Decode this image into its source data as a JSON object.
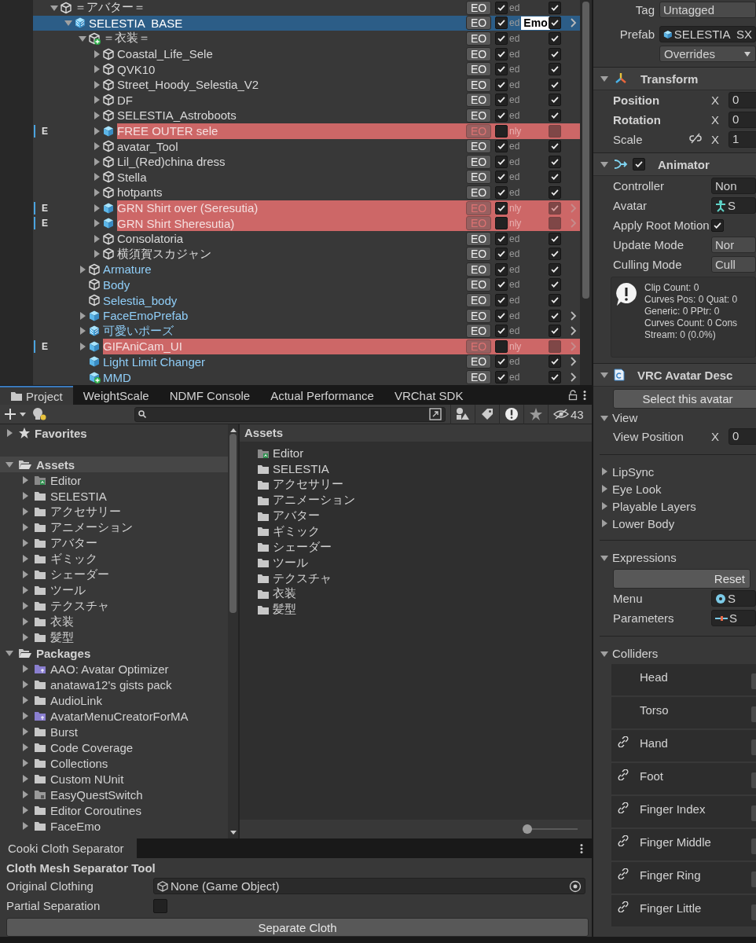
{
  "hierarchy": {
    "rows": [
      {
        "name": "＝アバター＝",
        "kind": "object",
        "expanded": true,
        "selected": false,
        "editor_only": false,
        "in_prefab": false,
        "eo_button": "EO",
        "active": true,
        "status_text": "ed",
        "included": true,
        "chevron": false,
        "children": [
          {
            "name": "SELESTIA  BASE",
            "kind": "prefab_variant",
            "expanded": true,
            "selected": true,
            "editor_only": false,
            "in_prefab": false,
            "eo_button": "EO",
            "active": true,
            "status_text": "ed",
            "tag": "Emo",
            "included": true,
            "chevron": true,
            "children": [
              {
                "name": "＝衣装＝",
                "kind": "added",
                "expanded": true,
                "selected": false,
                "editor_only": false,
                "in_prefab": false,
                "eo_button": "EO",
                "active": true,
                "status_text": "ed",
                "included": true,
                "chevron": false,
                "children": [
                  {
                    "name": "Coastal_Life_Sele",
                    "kind": "object",
                    "expanded": false,
                    "selected": false,
                    "editor_only": false,
                    "in_prefab": false,
                    "eo_button": "EO",
                    "active": true,
                    "status_text": "ed",
                    "included": true,
                    "chevron": false
                  },
                  {
                    "name": "QVK10",
                    "kind": "object",
                    "expanded": false,
                    "selected": false,
                    "editor_only": false,
                    "in_prefab": false,
                    "eo_button": "EO",
                    "active": true,
                    "status_text": "ed",
                    "included": true,
                    "chevron": false
                  },
                  {
                    "name": "Street_Hoody_Selestia_V2",
                    "kind": "object",
                    "expanded": false,
                    "selected": false,
                    "editor_only": false,
                    "in_prefab": false,
                    "eo_button": "EO",
                    "active": true,
                    "status_text": "ed",
                    "included": true,
                    "chevron": false
                  },
                  {
                    "name": "DF",
                    "kind": "object",
                    "expanded": false,
                    "selected": false,
                    "editor_only": false,
                    "in_prefab": false,
                    "eo_button": "EO",
                    "active": true,
                    "status_text": "ed",
                    "included": true,
                    "chevron": false
                  },
                  {
                    "name": "SELESTIA_Astroboots",
                    "kind": "object",
                    "expanded": false,
                    "selected": false,
                    "editor_only": false,
                    "in_prefab": false,
                    "eo_button": "EO",
                    "active": true,
                    "status_text": "ed",
                    "included": true,
                    "chevron": false
                  },
                  {
                    "name": "FREE OUTER sele",
                    "kind": "prefab",
                    "expanded": false,
                    "selected": false,
                    "editor_only": true,
                    "gutter_mark": "E",
                    "in_prefab": false,
                    "eo_button": "EO",
                    "active": false,
                    "status_text": "nly",
                    "included": false,
                    "chevron": false
                  },
                  {
                    "name": "avatar_Tool",
                    "kind": "object",
                    "expanded": false,
                    "selected": false,
                    "editor_only": false,
                    "in_prefab": false,
                    "eo_button": "EO",
                    "active": true,
                    "status_text": "ed",
                    "included": true,
                    "chevron": false
                  },
                  {
                    "name": "Lil_(Red)china dress",
                    "kind": "object",
                    "expanded": false,
                    "selected": false,
                    "editor_only": false,
                    "in_prefab": false,
                    "eo_button": "EO",
                    "active": true,
                    "status_text": "ed",
                    "included": true,
                    "chevron": false
                  },
                  {
                    "name": "Stella",
                    "kind": "object",
                    "expanded": false,
                    "selected": false,
                    "editor_only": false,
                    "in_prefab": false,
                    "eo_button": "EO",
                    "active": true,
                    "status_text": "ed",
                    "included": true,
                    "chevron": false
                  },
                  {
                    "name": "hotpants",
                    "kind": "object",
                    "expanded": false,
                    "selected": false,
                    "editor_only": false,
                    "in_prefab": false,
                    "eo_button": "EO",
                    "active": true,
                    "status_text": "ed",
                    "included": true,
                    "chevron": false
                  },
                  {
                    "name": "GRN Shirt over (Seresutia)",
                    "kind": "prefab",
                    "expanded": false,
                    "selected": false,
                    "editor_only": true,
                    "gutter_mark": "E",
                    "in_prefab": false,
                    "eo_button": "EO",
                    "active": true,
                    "status_text": "nly",
                    "included": true,
                    "chevron": true
                  },
                  {
                    "name": "GRN Shirt Sheresutia)",
                    "kind": "prefab",
                    "expanded": false,
                    "selected": false,
                    "editor_only": true,
                    "gutter_mark": "E",
                    "in_prefab": false,
                    "eo_button": "EO",
                    "active": false,
                    "status_text": "nly",
                    "included": false,
                    "chevron": true
                  },
                  {
                    "name": "Consolatoria",
                    "kind": "object",
                    "expanded": false,
                    "selected": false,
                    "editor_only": false,
                    "in_prefab": false,
                    "eo_button": "EO",
                    "active": true,
                    "status_text": "ed",
                    "included": true,
                    "chevron": false
                  },
                  {
                    "name": "横須賀スカジャン",
                    "kind": "object",
                    "expanded": false,
                    "selected": false,
                    "editor_only": false,
                    "in_prefab": false,
                    "eo_button": "EO",
                    "active": true,
                    "status_text": "ed",
                    "included": true,
                    "chevron": false
                  }
                ]
              },
              {
                "name": "Armature",
                "kind": "object",
                "expanded": false,
                "selected": false,
                "editor_only": false,
                "in_prefab": true,
                "eo_button": "EO",
                "active": true,
                "status_text": "ed",
                "included": true,
                "chevron": false
              },
              {
                "name": "Body",
                "kind": "object",
                "selected": false,
                "editor_only": false,
                "in_prefab": true,
                "eo_button": "EO",
                "active": true,
                "status_text": "ed",
                "included": true,
                "chevron": false
              },
              {
                "name": "Selestia_body",
                "kind": "object",
                "selected": false,
                "editor_only": false,
                "in_prefab": true,
                "eo_button": "EO",
                "active": true,
                "status_text": "ed",
                "included": true,
                "chevron": false
              },
              {
                "name": "FaceEmoPrefab",
                "kind": "prefab",
                "expanded": false,
                "selected": false,
                "editor_only": false,
                "in_prefab": true,
                "eo_button": "EO",
                "active": true,
                "status_text": "ed",
                "included": true,
                "chevron": true
              },
              {
                "name": "可愛いポーズ",
                "kind": "prefab_variant",
                "expanded": false,
                "selected": false,
                "editor_only": false,
                "in_prefab": true,
                "eo_button": "EO",
                "active": true,
                "status_text": "ed",
                "included": true,
                "chevron": true
              },
              {
                "name": "GIFAniCam_UI",
                "kind": "prefab",
                "expanded": false,
                "selected": false,
                "editor_only": true,
                "gutter_mark": "E",
                "in_prefab": true,
                "eo_button": "EO",
                "active": false,
                "status_text": "nly",
                "included": false,
                "chevron": true
              },
              {
                "name": "Light Limit Changer",
                "kind": "prefab",
                "selected": false,
                "editor_only": false,
                "in_prefab": true,
                "eo_button": "EO",
                "active": true,
                "status_text": "ed",
                "included": true,
                "chevron": true
              },
              {
                "name": "MMD",
                "kind": "prefab_added",
                "selected": false,
                "editor_only": false,
                "in_prefab": true,
                "eo_button": "EO",
                "active": true,
                "status_text": "ed",
                "included": true,
                "chevron": true
              }
            ]
          }
        ]
      }
    ]
  },
  "project": {
    "tabs": [
      {
        "label": "Project",
        "selected": true
      },
      {
        "label": "WeightScale",
        "selected": false
      },
      {
        "label": "NDMF Console",
        "selected": false
      },
      {
        "label": "Actual Performance",
        "selected": false
      },
      {
        "label": "VRChat SDK",
        "selected": false
      }
    ],
    "hidden_count": "43",
    "tree": [
      {
        "name": "Favorites",
        "kind": "favorites",
        "expanded": false,
        "selected": false
      },
      {
        "name": "Assets",
        "kind": "root",
        "expanded": true,
        "selected": true,
        "children": [
          {
            "name": "Editor",
            "kind": "editor",
            "expanded": false,
            "selected": false
          },
          {
            "name": "SELESTIA",
            "kind": "folder",
            "expanded": false,
            "selected": false
          },
          {
            "name": "アクセサリー",
            "kind": "folder",
            "expanded": false,
            "selected": false
          },
          {
            "name": "アニメーション",
            "kind": "folder",
            "expanded": false,
            "selected": false
          },
          {
            "name": "アバター",
            "kind": "folder",
            "expanded": false,
            "selected": false
          },
          {
            "name": "ギミック",
            "kind": "folder",
            "expanded": false,
            "selected": false
          },
          {
            "name": "シェーダー",
            "kind": "folder",
            "expanded": false,
            "selected": false
          },
          {
            "name": "ツール",
            "kind": "folder",
            "expanded": false,
            "selected": false
          },
          {
            "name": "テクスチャ",
            "kind": "folder",
            "expanded": false,
            "selected": false
          },
          {
            "name": "衣装",
            "kind": "folder",
            "expanded": false,
            "selected": false
          },
          {
            "name": "髪型",
            "kind": "folder",
            "expanded": false,
            "selected": false
          }
        ]
      },
      {
        "name": "Packages",
        "kind": "root",
        "expanded": true,
        "selected": false,
        "children": [
          {
            "name": "AAO: Avatar Optimizer",
            "kind": "package",
            "expanded": false,
            "selected": false
          },
          {
            "name": "anatawa12's gists pack",
            "kind": "folder",
            "expanded": false,
            "selected": false
          },
          {
            "name": "AudioLink",
            "kind": "folder",
            "expanded": false,
            "selected": false
          },
          {
            "name": "AvatarMenuCreatorForMA",
            "kind": "package",
            "expanded": false,
            "selected": false
          },
          {
            "name": "Burst",
            "kind": "folder",
            "expanded": false,
            "selected": false
          },
          {
            "name": "Code Coverage",
            "kind": "folder",
            "expanded": false,
            "selected": false
          },
          {
            "name": "Collections",
            "kind": "folder",
            "expanded": false,
            "selected": false
          },
          {
            "name": "Custom NUnit",
            "kind": "folder",
            "expanded": false,
            "selected": false
          },
          {
            "name": "EasyQuestSwitch",
            "kind": "grey",
            "expanded": false,
            "selected": false
          },
          {
            "name": "Editor Coroutines",
            "kind": "folder",
            "expanded": false,
            "selected": false
          },
          {
            "name": "FaceEmo",
            "kind": "folder",
            "expanded": false,
            "selected": false
          }
        ]
      }
    ],
    "assets_header": "Assets",
    "items": [
      {
        "name": "Editor",
        "kind": "editor"
      },
      {
        "name": "SELESTIA",
        "kind": "folder"
      },
      {
        "name": "アクセサリー",
        "kind": "folder"
      },
      {
        "name": "アニメーション",
        "kind": "folder"
      },
      {
        "name": "アバター",
        "kind": "folder"
      },
      {
        "name": "ギミック",
        "kind": "folder"
      },
      {
        "name": "シェーダー",
        "kind": "folder"
      },
      {
        "name": "ツール",
        "kind": "folder"
      },
      {
        "name": "テクスチャ",
        "kind": "folder"
      },
      {
        "name": "衣装",
        "kind": "folder"
      },
      {
        "name": "髪型",
        "kind": "folder"
      }
    ],
    "zoom_slider": {
      "level": 0
    }
  },
  "tool": {
    "tab": "Cooki Cloth Separator",
    "heading": "Cloth Mesh Separator Tool",
    "fields": [
      {
        "kind": "object",
        "label": "Original Clothing",
        "value": "None (Game Object)"
      },
      {
        "kind": "checkbox",
        "label": "Partial Separation",
        "checked": false
      }
    ],
    "button": "Separate Cloth"
  },
  "inspector": [
    {
      "kind": "tag_field",
      "label": "Tag",
      "value": "Untagged"
    },
    {
      "kind": "prefab_field",
      "label": "Prefab",
      "value": "SELESTIA  SX"
    },
    {
      "kind": "dropdown",
      "value": "Overrides"
    },
    {
      "kind": "transform_header",
      "title": "Transform",
      "expanded": true,
      "children": [
        {
          "kind": "vector",
          "label": "Position",
          "axis": "X",
          "value": "0",
          "bold": true,
          "constrain": false
        },
        {
          "kind": "vector",
          "label": "Rotation",
          "axis": "X",
          "value": "0",
          "bold": true,
          "constrain": false
        },
        {
          "kind": "vector",
          "label": "Scale",
          "axis": "X",
          "value": "1",
          "bold": false,
          "constrain": true
        }
      ]
    },
    {
      "kind": "animator_header",
      "title": "Animator",
      "expanded": true,
      "enabled": true,
      "children": [
        {
          "kind": "object_field",
          "label": "Controller",
          "value": "Non"
        },
        {
          "kind": "avatar_field",
          "label": "Avatar",
          "value": "S"
        },
        {
          "kind": "toggle",
          "label": "Apply Root Motion",
          "checked": true
        },
        {
          "kind": "popup_field",
          "label": "Update Mode",
          "value": "Nor"
        },
        {
          "kind": "popup_field",
          "label": "Culling Mode",
          "value": "Cull"
        },
        {
          "kind": "info",
          "lines": [
            "Clip Count: 0",
            "Curves Pos: 0 Quat: 0",
            "Generic: 0 PPtr: 0",
            "Curves Count: 0 Cons",
            "Stream: 0 (0.0%)"
          ]
        }
      ]
    },
    {
      "kind": "script_header",
      "title": "VRC Avatar Desc",
      "expanded": true,
      "children": [
        {
          "kind": "button",
          "label": "Select this avatar"
        },
        {
          "kind": "foldout",
          "label": "View",
          "expanded": true,
          "children": [
            {
              "kind": "vector",
              "label": "View Position",
              "axis": "X",
              "value": "0",
              "bold": false,
              "constrain": false
            }
          ]
        },
        {
          "kind": "divider"
        },
        {
          "kind": "foldout",
          "label": "LipSync",
          "expanded": false
        },
        {
          "kind": "foldout",
          "label": "Eye Look",
          "expanded": false
        },
        {
          "kind": "foldout",
          "label": "Playable Layers",
          "expanded": false
        },
        {
          "kind": "foldout",
          "label": "Lower Body",
          "expanded": false
        },
        {
          "kind": "divider"
        },
        {
          "kind": "foldout",
          "label": "Expressions",
          "expanded": true,
          "children": [
            {
              "kind": "wide_button",
              "label": "Reset"
            },
            {
              "kind": "menu_field",
              "label": "Menu",
              "value": "S"
            },
            {
              "kind": "params_field",
              "label": "Parameters",
              "value": "S"
            }
          ]
        },
        {
          "kind": "divider"
        },
        {
          "kind": "foldout",
          "label": "Colliders",
          "expanded": true,
          "children": [
            {
              "kind": "collider",
              "label": "Head",
              "linked": false
            },
            {
              "kind": "collider",
              "label": "Torso",
              "linked": false
            },
            {
              "kind": "collider",
              "label": "Hand",
              "linked": true
            },
            {
              "kind": "collider",
              "label": "Foot",
              "linked": true
            },
            {
              "kind": "collider",
              "label": "Finger Index",
              "linked": true
            },
            {
              "kind": "collider",
              "label": "Finger Middle",
              "linked": true
            },
            {
              "kind": "collider",
              "label": "Finger Ring",
              "linked": true
            },
            {
              "kind": "collider",
              "label": "Finger Little",
              "linked": true
            }
          ]
        }
      ]
    }
  ]
}
